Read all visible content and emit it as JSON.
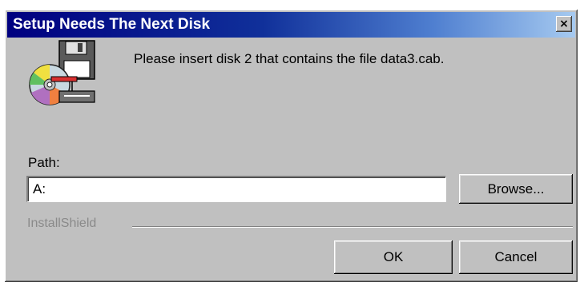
{
  "dialog": {
    "title": "Setup Needs The Next Disk",
    "close_label": "×",
    "message": "Please insert disk 2 that contains the file data3.cab.",
    "icon": "disk-icon"
  },
  "path": {
    "label": "Path:",
    "value": "A:"
  },
  "buttons": {
    "browse": "Browse...",
    "ok": "OK",
    "cancel": "Cancel"
  },
  "branding": "InstallShield",
  "colors": {
    "title_gradient_start": "#000080",
    "title_gradient_end": "#a6caf0",
    "face": "#c0c0c0"
  }
}
